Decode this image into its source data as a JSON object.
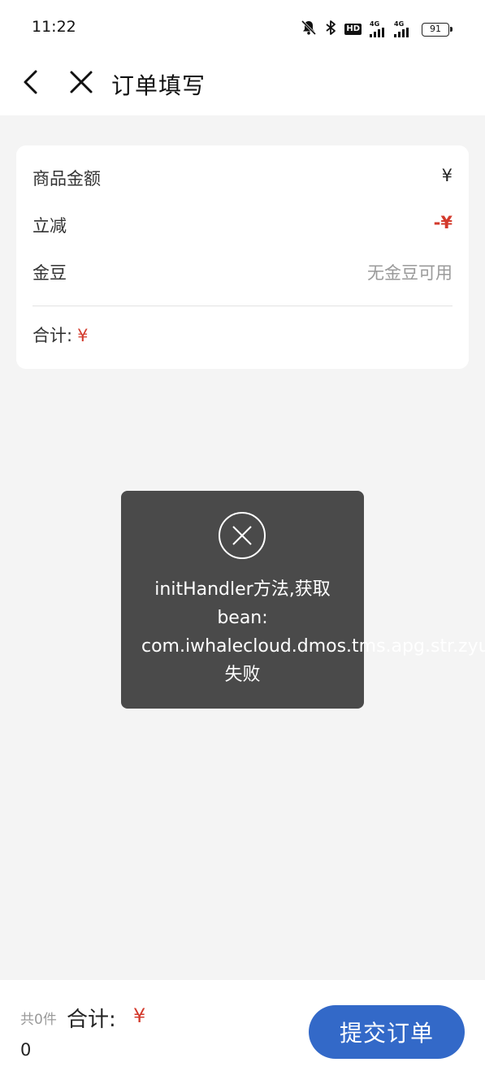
{
  "status_bar": {
    "time": "11:22",
    "hd_badge": "HD",
    "network_1": "4G",
    "network_2": "4G",
    "battery": "91",
    "icons": [
      "mute-bell-icon",
      "bluetooth-icon",
      "hd-icon",
      "signal-icon",
      "signal-icon",
      "battery-icon"
    ]
  },
  "nav": {
    "title": "订单填写",
    "back_icon": "chevron-left-icon",
    "close_icon": "close-icon"
  },
  "price_card": {
    "rows": [
      {
        "label": "商品金额",
        "value": "¥"
      },
      {
        "label": "立减",
        "value": "-¥"
      },
      {
        "label": "金豆",
        "value": "无金豆可用"
      }
    ],
    "total_label": "合计:",
    "total_currency": "¥"
  },
  "toast": {
    "icon": "error-circle-x-icon",
    "line1": "initHandler方法,获取",
    "line2": "bean:",
    "line3": "com.iwhalecloud.dmos.tms.apg.str.zyu.t",
    "line4": "失败"
  },
  "bottom_bar": {
    "item_count": "共0件",
    "total_label": "合计:",
    "total_currency": "¥",
    "amount": "0",
    "submit_label": "提交订单"
  },
  "colors": {
    "accent_blue": "#3369c8",
    "price_red": "#d33a2c",
    "toast_bg": "#4a4a4a",
    "page_bg": "#f4f4f4"
  }
}
